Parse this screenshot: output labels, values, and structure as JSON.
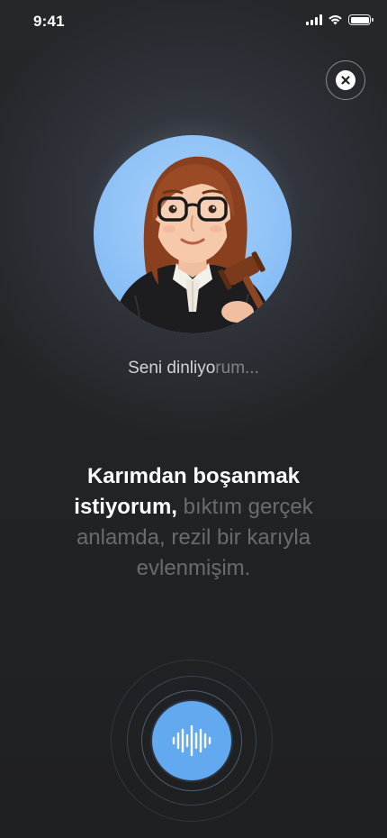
{
  "status_bar": {
    "time": "9:41"
  },
  "listening": {
    "main": "Seni dinliyo",
    "fade": "rum..."
  },
  "transcript": {
    "strong": "Karımdan boşanmak istiyorum,",
    "dim": " bıktım gerçek anlamda, rezil bir karıyla evlenmişim."
  },
  "icons": {
    "close": "close-icon",
    "mic": "voice-wave-icon",
    "signal": "cellular-signal-icon",
    "wifi": "wifi-icon",
    "battery": "battery-icon"
  },
  "colors": {
    "accent": "#62a9ef",
    "avatar_bg": "#8fc2f7",
    "background": "#202123"
  }
}
